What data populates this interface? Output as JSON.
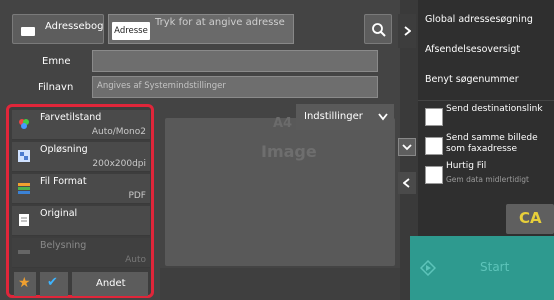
{
  "header": {
    "addressbook_label": "Adressebog",
    "address_tag": "Adresse",
    "address_placeholder": "Tryk for at angive adresse"
  },
  "fields": {
    "subject_label": "Emne",
    "filename_label": "Filnavn",
    "filename_placeholder": "Angives af Systemindstillinger"
  },
  "preview": {
    "paper": "A4",
    "image_label": "Image",
    "settings_label": "Indstillinger"
  },
  "settings": [
    {
      "label": "Farvetilstand",
      "value": "Auto/Mono2",
      "icon": "color-mode-icon"
    },
    {
      "label": "Opløsning",
      "value": "200x200dpi",
      "icon": "resolution-icon"
    },
    {
      "label": "Fil Format",
      "value": "PDF",
      "icon": "file-format-icon"
    },
    {
      "label": "Original",
      "value": "",
      "icon": "original-icon"
    },
    {
      "label": "Belysning",
      "value": "Auto",
      "icon": "exposure-icon"
    }
  ],
  "bottom": {
    "other_label": "Andet"
  },
  "right": {
    "global_search": "Global adressesøgning",
    "send_history": "Afsendelsesoversigt",
    "use_search_number": "Benyt søgenummer",
    "send_link": "Send destinationslink",
    "send_same_image": "Send samme billede som faxadresse",
    "quick_file": "Hurtig Fil",
    "quick_file_sub": "Gem data midlertidigt",
    "ca_label": "CA",
    "start_label": "Start"
  },
  "colors": {
    "highlight": "#e0263a",
    "start": "#2e9a8f",
    "ca": "#e7cf3a"
  }
}
